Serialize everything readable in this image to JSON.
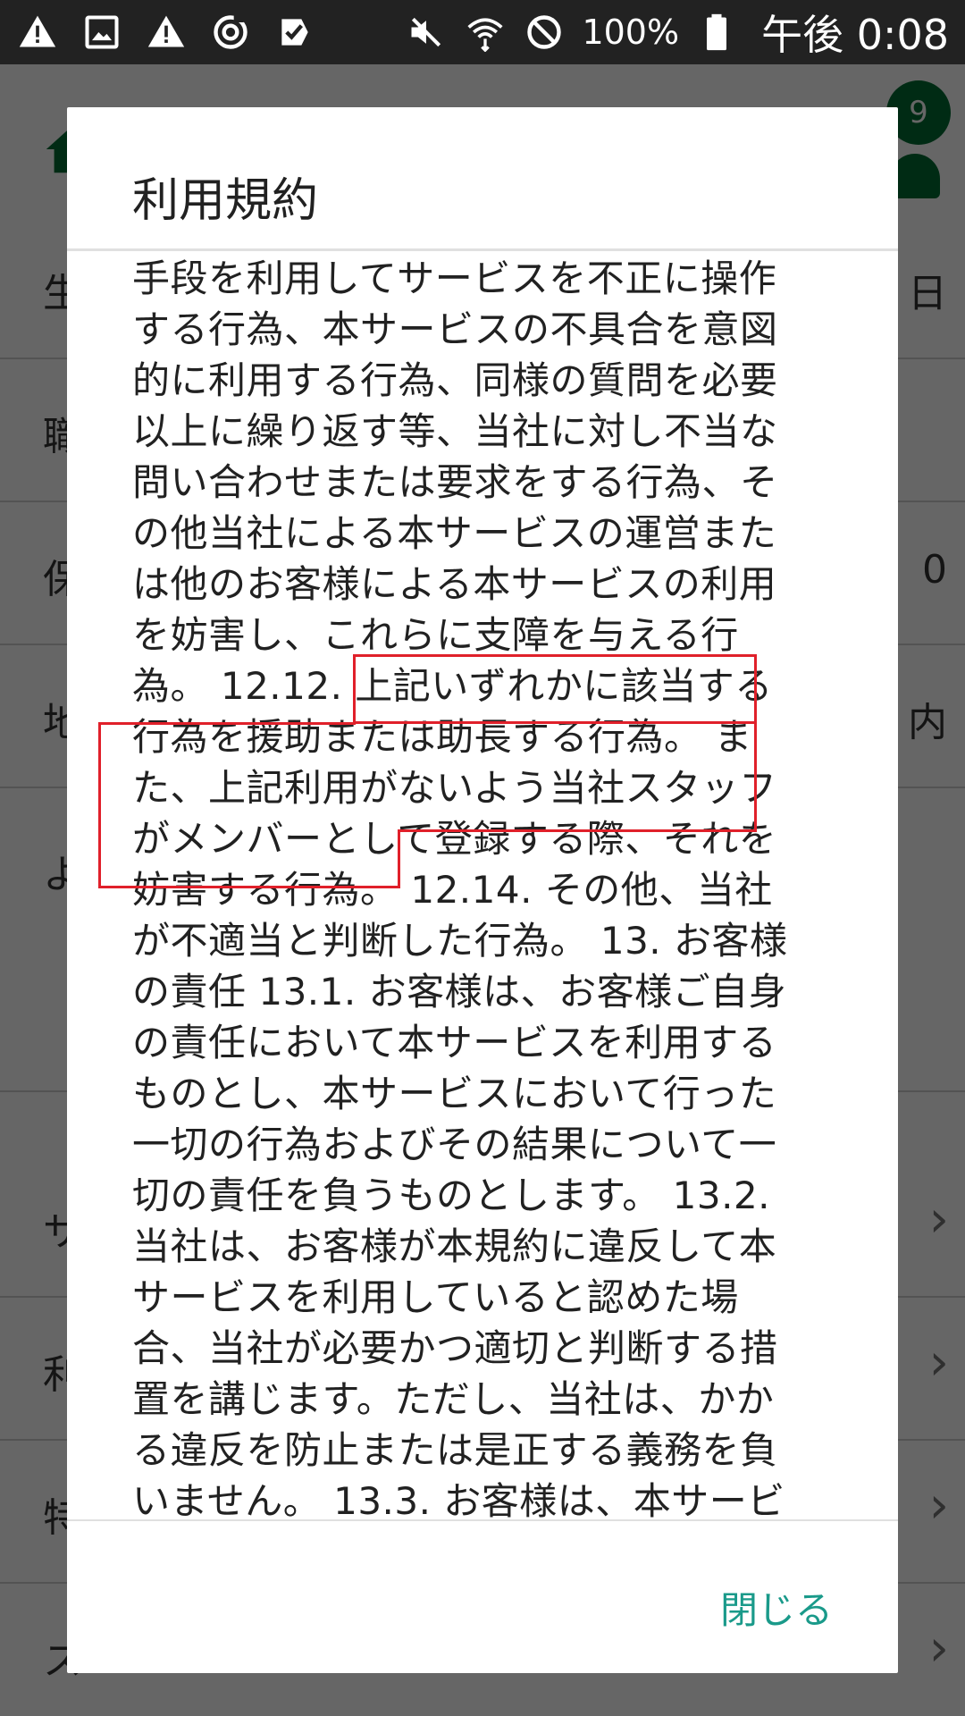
{
  "status_bar": {
    "left_icons": [
      "warning-icon",
      "image-icon",
      "warning-icon",
      "sync-icon",
      "task-done-icon"
    ],
    "right_icons": [
      "mute-icon",
      "wifi-icon",
      "do-not-disturb-icon",
      "battery-icon"
    ],
    "battery": "100%",
    "time": "午後 0:08"
  },
  "background": {
    "badge_count": "9",
    "rows": [
      {
        "label": "生",
        "value": "日"
      },
      {
        "label": "職",
        "value": ""
      },
      {
        "label": "保",
        "value": "0"
      },
      {
        "label": "地",
        "value": "内"
      },
      {
        "label": "よ",
        "value": ""
      },
      {
        "label": "サ",
        "value": ""
      },
      {
        "label": "利",
        "value": ""
      },
      {
        "label": "特",
        "value": ""
      },
      {
        "label": "ス",
        "value": ""
      }
    ]
  },
  "dialog": {
    "title": "利用規約",
    "lines": [
      "手段を利用してサービスを不正に操作",
      "する行為、本サービスの不具合を意図",
      "的に利用する行為、同様の質問を必要",
      "以上に繰り返す等、当社に対し不当な",
      "問い合わせまたは要求をする行為、そ",
      "の他当社による本サービスの運営また",
      "は他のお客様による本サービスの利用",
      "を妨害し、これらに支障を与える行",
      "為。 12.12. 上記いずれかに該当する",
      "行為を援助または助長する行為。 ま",
      "た、上記利用がないよう当社スタッフ",
      "がメンバーとして登録する際、それを",
      "妨害する行為。 12.14. その他、当社",
      "が不適当と判断した行為。 13. お客様",
      "の責任 13.1. お客様は、お客様ご自身",
      "の責任において本サービスを利用する",
      "ものとし、本サービスにおいて行った",
      "一切の行為およびその結果について一",
      "切の責任を負うものとします。 13.2.",
      "当社は、お客様が本規約に違反して本",
      "サービスを利用していると認めた場",
      "合、当社が必要かつ適切と判断する措",
      "置を講じます。ただし、当社は、かか",
      "る違反を防止または是正する義務を負",
      "いません。 13.3. お客様は、本サービ"
    ],
    "close_label": "閉じる"
  }
}
